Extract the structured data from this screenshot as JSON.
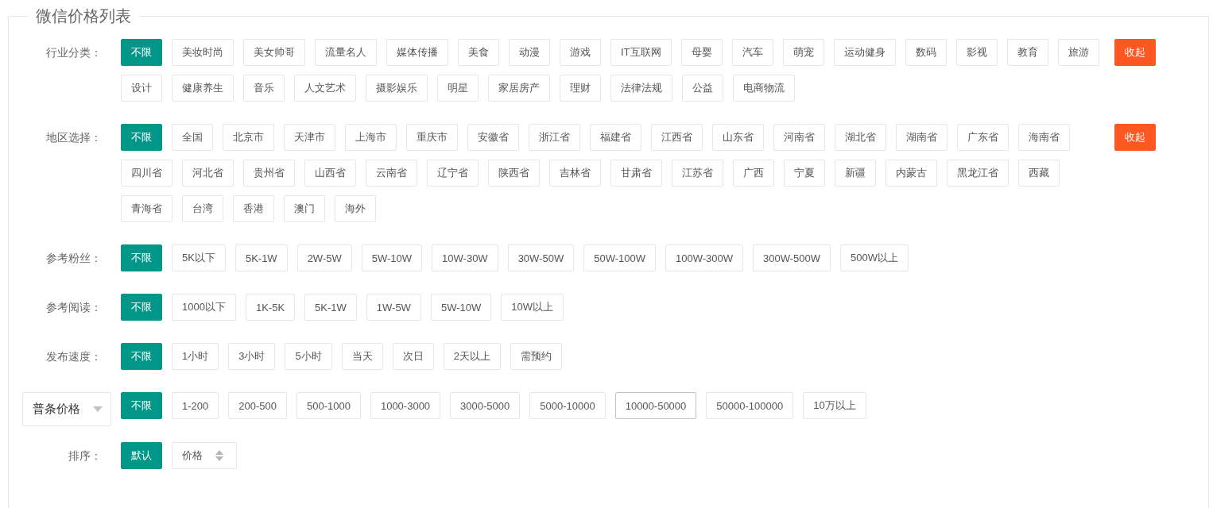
{
  "title": "微信价格列表",
  "filters": [
    {
      "kind": "text",
      "label": "行业分类：",
      "collapse": "收起",
      "options": [
        {
          "label": "不限",
          "selected": true
        },
        {
          "label": "美妆时尚",
          "selected": false
        },
        {
          "label": "美女帅哥",
          "selected": false
        },
        {
          "label": "流量名人",
          "selected": false
        },
        {
          "label": "媒体传播",
          "selected": false
        },
        {
          "label": "美食",
          "selected": false
        },
        {
          "label": "动漫",
          "selected": false
        },
        {
          "label": "游戏",
          "selected": false
        },
        {
          "label": "IT互联网",
          "selected": false
        },
        {
          "label": "母婴",
          "selected": false
        },
        {
          "label": "汽车",
          "selected": false
        },
        {
          "label": "萌宠",
          "selected": false
        },
        {
          "label": "运动健身",
          "selected": false
        },
        {
          "label": "数码",
          "selected": false
        },
        {
          "label": "影视",
          "selected": false
        },
        {
          "label": "教育",
          "selected": false
        },
        {
          "label": "旅游",
          "selected": false
        },
        {
          "label": "设计",
          "selected": false
        },
        {
          "label": "健康养生",
          "selected": false
        },
        {
          "label": "音乐",
          "selected": false
        },
        {
          "label": "人文艺术",
          "selected": false
        },
        {
          "label": "摄影娱乐",
          "selected": false
        },
        {
          "label": "明星",
          "selected": false
        },
        {
          "label": "家居房产",
          "selected": false
        },
        {
          "label": "理财",
          "selected": false
        },
        {
          "label": "法律法规",
          "selected": false
        },
        {
          "label": "公益",
          "selected": false
        },
        {
          "label": "电商物流",
          "selected": false
        }
      ]
    },
    {
      "kind": "text",
      "label": "地区选择：",
      "collapse": "收起",
      "options": [
        {
          "label": "不限",
          "selected": true
        },
        {
          "label": "全国",
          "selected": false
        },
        {
          "label": "北京市",
          "selected": false
        },
        {
          "label": "天津市",
          "selected": false
        },
        {
          "label": "上海市",
          "selected": false
        },
        {
          "label": "重庆市",
          "selected": false
        },
        {
          "label": "安徽省",
          "selected": false
        },
        {
          "label": "浙江省",
          "selected": false
        },
        {
          "label": "福建省",
          "selected": false
        },
        {
          "label": "江西省",
          "selected": false
        },
        {
          "label": "山东省",
          "selected": false
        },
        {
          "label": "河南省",
          "selected": false
        },
        {
          "label": "湖北省",
          "selected": false
        },
        {
          "label": "湖南省",
          "selected": false
        },
        {
          "label": "广东省",
          "selected": false
        },
        {
          "label": "海南省",
          "selected": false
        },
        {
          "label": "四川省",
          "selected": false
        },
        {
          "label": "河北省",
          "selected": false
        },
        {
          "label": "贵州省",
          "selected": false
        },
        {
          "label": "山西省",
          "selected": false
        },
        {
          "label": "云南省",
          "selected": false
        },
        {
          "label": "辽宁省",
          "selected": false
        },
        {
          "label": "陕西省",
          "selected": false
        },
        {
          "label": "吉林省",
          "selected": false
        },
        {
          "label": "甘肃省",
          "selected": false
        },
        {
          "label": "江苏省",
          "selected": false
        },
        {
          "label": "广西",
          "selected": false
        },
        {
          "label": "宁夏",
          "selected": false
        },
        {
          "label": "新疆",
          "selected": false
        },
        {
          "label": "内蒙古",
          "selected": false
        },
        {
          "label": "黑龙江省",
          "selected": false
        },
        {
          "label": "西藏",
          "selected": false
        },
        {
          "label": "青海省",
          "selected": false
        },
        {
          "label": "台湾",
          "selected": false
        },
        {
          "label": "香港",
          "selected": false
        },
        {
          "label": "澳门",
          "selected": false
        },
        {
          "label": "海外",
          "selected": false
        }
      ]
    },
    {
      "kind": "text",
      "label": "参考粉丝：",
      "options": [
        {
          "label": "不限",
          "selected": true
        },
        {
          "label": "5K以下",
          "selected": false
        },
        {
          "label": "5K-1W",
          "selected": false
        },
        {
          "label": "2W-5W",
          "selected": false
        },
        {
          "label": "5W-10W",
          "selected": false
        },
        {
          "label": "10W-30W",
          "selected": false
        },
        {
          "label": "30W-50W",
          "selected": false
        },
        {
          "label": "50W-100W",
          "selected": false
        },
        {
          "label": "100W-300W",
          "selected": false
        },
        {
          "label": "300W-500W",
          "selected": false
        },
        {
          "label": "500W以上",
          "selected": false
        }
      ]
    },
    {
      "kind": "text",
      "label": "参考阅读：",
      "options": [
        {
          "label": "不限",
          "selected": true
        },
        {
          "label": "1000以下",
          "selected": false
        },
        {
          "label": "1K-5K",
          "selected": false
        },
        {
          "label": "5K-1W",
          "selected": false
        },
        {
          "label": "1W-5W",
          "selected": false
        },
        {
          "label": "5W-10W",
          "selected": false
        },
        {
          "label": "10W以上",
          "selected": false
        }
      ]
    },
    {
      "kind": "text",
      "label": "发布速度：",
      "options": [
        {
          "label": "不限",
          "selected": true
        },
        {
          "label": "1小时",
          "selected": false
        },
        {
          "label": "3小时",
          "selected": false
        },
        {
          "label": "5小时",
          "selected": false
        },
        {
          "label": "当天",
          "selected": false
        },
        {
          "label": "次日",
          "selected": false
        },
        {
          "label": "2天以上",
          "selected": false
        },
        {
          "label": "需预约",
          "selected": false
        }
      ]
    },
    {
      "kind": "dropdown",
      "label": "普条价格",
      "options": [
        {
          "label": "不限",
          "selected": true,
          "hovered": false
        },
        {
          "label": "1-200",
          "selected": false,
          "hovered": false
        },
        {
          "label": "200-500",
          "selected": false,
          "hovered": false
        },
        {
          "label": "500-1000",
          "selected": false,
          "hovered": false
        },
        {
          "label": "1000-3000",
          "selected": false,
          "hovered": false
        },
        {
          "label": "3000-5000",
          "selected": false,
          "hovered": false
        },
        {
          "label": "5000-10000",
          "selected": false,
          "hovered": false
        },
        {
          "label": "10000-50000",
          "selected": false,
          "hovered": true
        },
        {
          "label": "50000-100000",
          "selected": false,
          "hovered": false
        },
        {
          "label": "10万以上",
          "selected": false,
          "hovered": false
        }
      ]
    },
    {
      "kind": "text",
      "label": "排序：",
      "options": [
        {
          "label": "默认",
          "selected": true,
          "kind": "plain"
        },
        {
          "label": "价格",
          "selected": false,
          "kind": "sortable"
        }
      ]
    }
  ]
}
